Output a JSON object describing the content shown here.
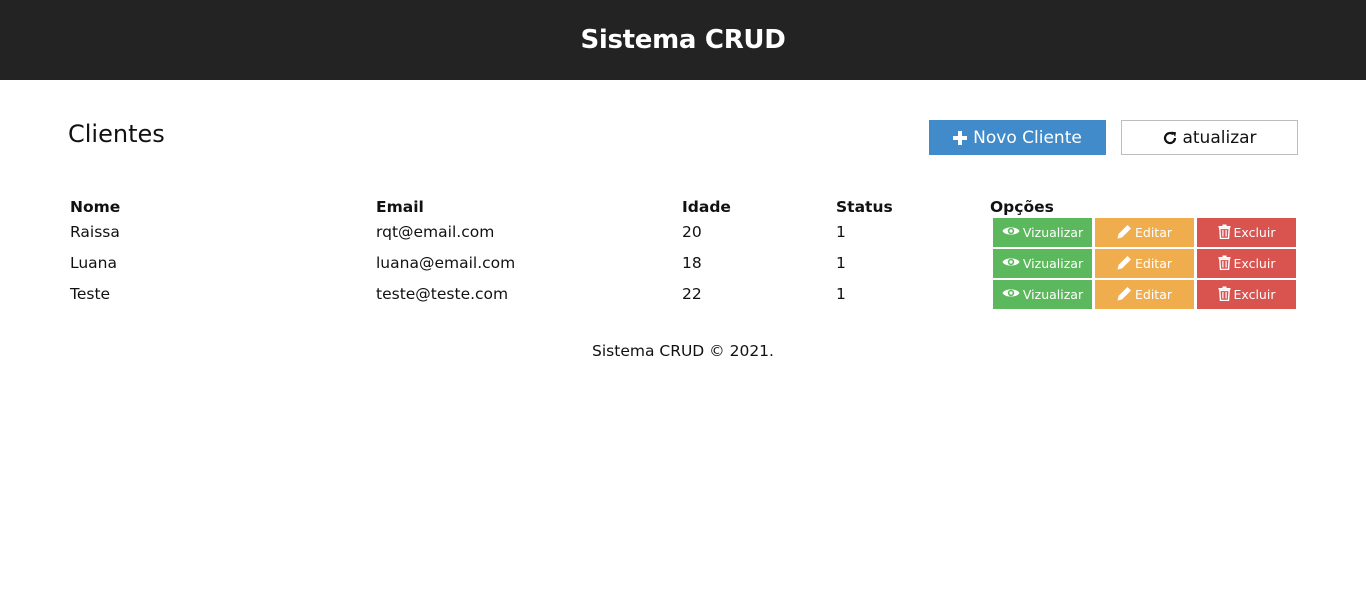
{
  "header": {
    "title": "Sistema CRUD"
  },
  "page": {
    "title": "Clientes",
    "new_button_label": "Novo Cliente",
    "refresh_button_label": "atualizar"
  },
  "table": {
    "columns": [
      "Nome",
      "Email",
      "Idade",
      "Status",
      "Opções"
    ],
    "rows": [
      {
        "nome": "Raissa",
        "email": "rqt@email.com",
        "idade": "20",
        "status": "1"
      },
      {
        "nome": "Luana",
        "email": "luana@email.com",
        "idade": "18",
        "status": "1"
      },
      {
        "nome": "Teste",
        "email": "teste@teste.com",
        "idade": "22",
        "status": "1"
      }
    ],
    "actions": {
      "view_label": "Vizualizar",
      "edit_label": "Editar",
      "delete_label": "Excluir"
    }
  },
  "footer": {
    "text": "Sistema CRUD © 2021."
  },
  "colors": {
    "topbar": "#232323",
    "primary": "#428bca",
    "view": "#5cb85c",
    "edit": "#f0ad4e",
    "delete": "#d9534f"
  },
  "icons": {
    "new_button": "plus-icon",
    "refresh_button": "refresh-icon",
    "view": "eye-icon",
    "edit": "pencil-icon",
    "delete": "trash-icon"
  }
}
